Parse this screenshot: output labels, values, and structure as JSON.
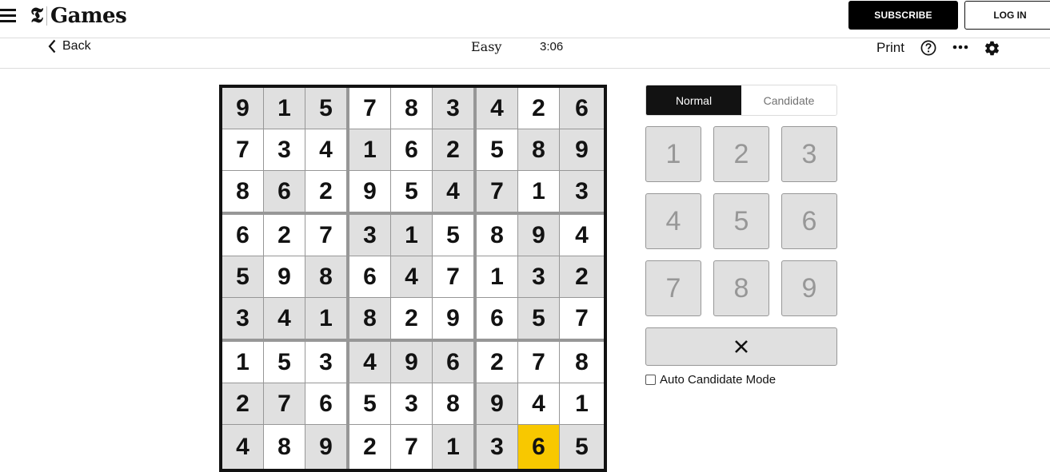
{
  "header": {
    "logo_mark": "𝕿",
    "logo_text": "Games",
    "subscribe_label": "SUBSCRIBE",
    "login_label": "LOG IN"
  },
  "toolbar": {
    "back_label": "Back",
    "difficulty": "Easy",
    "timer": "3:06",
    "print_label": "Print",
    "icons": [
      "help-icon",
      "more-icon",
      "gear-icon"
    ]
  },
  "board": {
    "values": [
      [
        9,
        1,
        5,
        7,
        8,
        3,
        4,
        2,
        6
      ],
      [
        7,
        3,
        4,
        1,
        6,
        2,
        5,
        8,
        9
      ],
      [
        8,
        6,
        2,
        9,
        5,
        4,
        7,
        1,
        3
      ],
      [
        6,
        2,
        7,
        3,
        1,
        5,
        8,
        9,
        4
      ],
      [
        5,
        9,
        8,
        6,
        4,
        7,
        1,
        3,
        2
      ],
      [
        3,
        4,
        1,
        8,
        2,
        9,
        6,
        5,
        7
      ],
      [
        1,
        5,
        3,
        4,
        9,
        6,
        2,
        7,
        8
      ],
      [
        2,
        7,
        6,
        5,
        3,
        8,
        9,
        4,
        1
      ],
      [
        4,
        8,
        9,
        2,
        7,
        1,
        3,
        6,
        5
      ]
    ],
    "shading": [
      "gggwwggwg",
      "wwwgwgwgg",
      "wgwwwggwg",
      "wwwggwwgw",
      "gwgwgwwgg",
      "ggggwwwgw",
      "wwwgggwww",
      "ggwwwwgww",
      "gwgwwggyg"
    ],
    "selected_cell": {
      "row": 9,
      "col": 8
    },
    "colors": {
      "given": "#e0e0e0",
      "blank": "#ffffff",
      "selected": "#f8c800"
    }
  },
  "controls": {
    "modes": [
      {
        "label": "Normal",
        "active": true
      },
      {
        "label": "Candidate",
        "active": false
      }
    ],
    "numpad": [
      "1",
      "2",
      "3",
      "4",
      "5",
      "6",
      "7",
      "8",
      "9"
    ],
    "delete_icon": "close-icon",
    "auto_candidate_label": "Auto Candidate Mode",
    "auto_candidate_checked": false
  }
}
